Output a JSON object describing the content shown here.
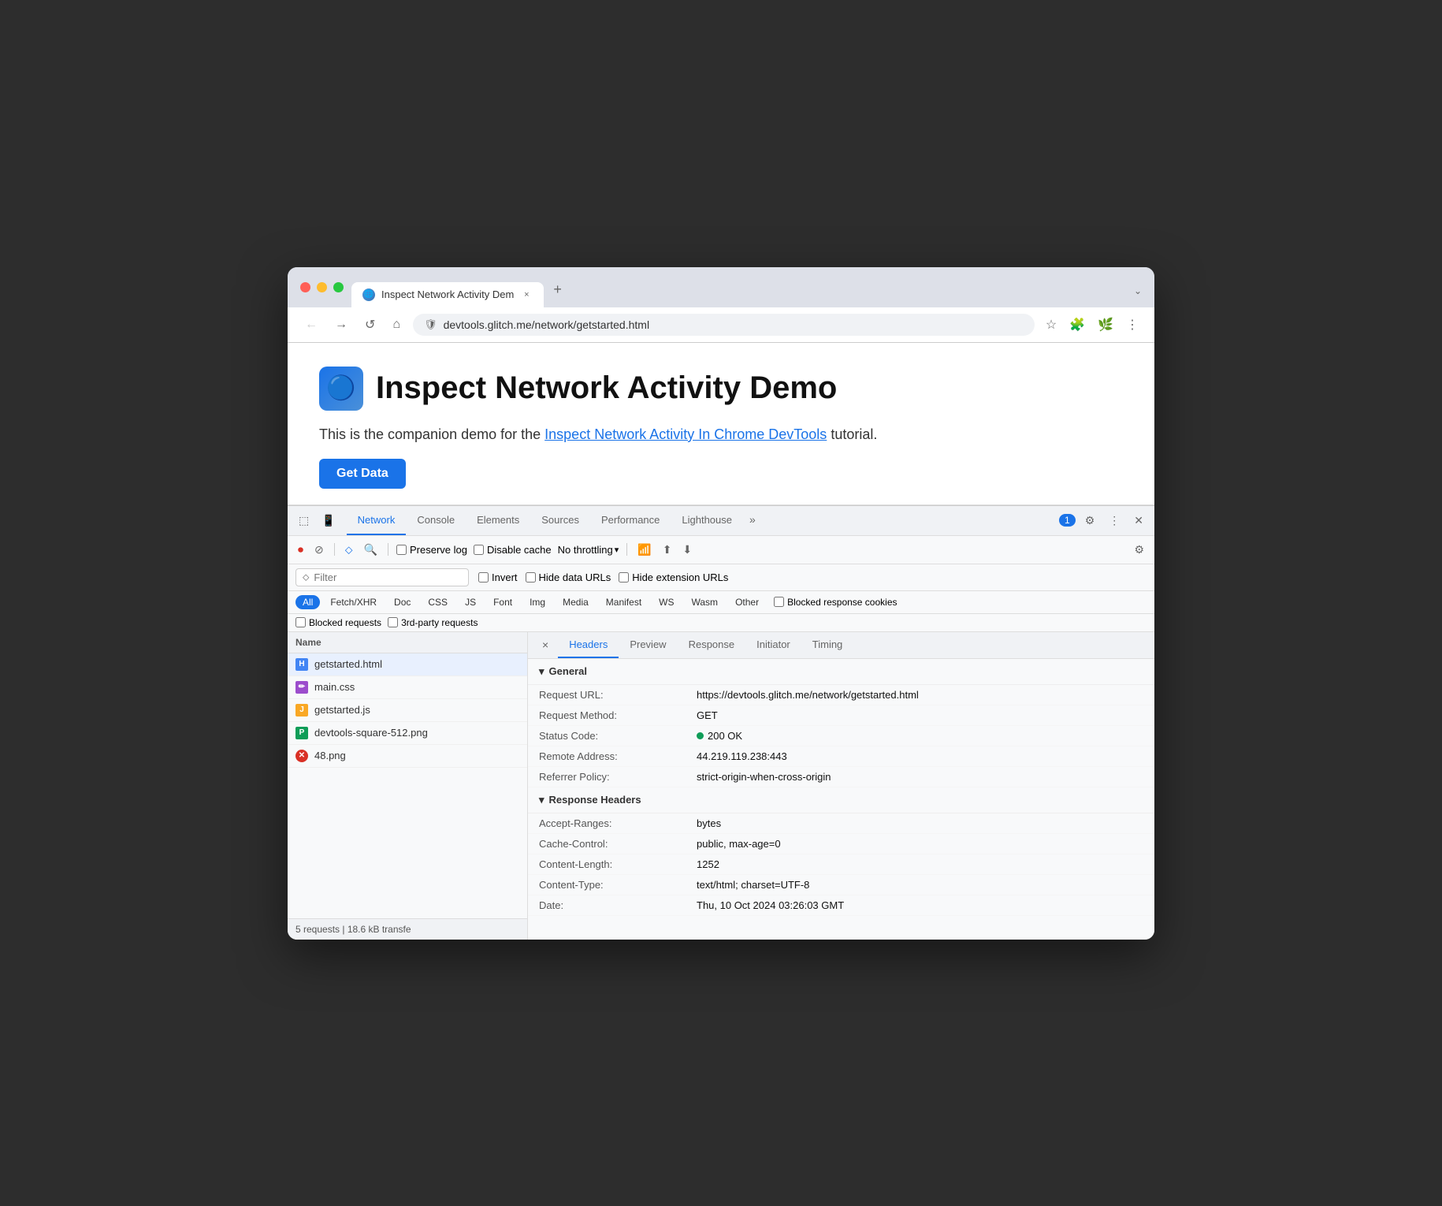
{
  "browser": {
    "tab_title": "Inspect Network Activity Dem",
    "tab_close": "×",
    "tab_new": "+",
    "url": "devtools.glitch.me/network/getstarted.html",
    "back_btn": "←",
    "forward_btn": "→",
    "refresh_btn": "↺",
    "home_btn": "⌂",
    "chevron_down": "⌄"
  },
  "page": {
    "title": "Inspect Network Activity Demo",
    "subtitle_before": "This is the companion demo for the ",
    "subtitle_link": "Inspect Network Activity In Chrome DevTools",
    "subtitle_after": " tutorial.",
    "cta_label": "Get Data",
    "logo_emoji": "🔵"
  },
  "devtools": {
    "tabs": [
      {
        "label": "Network",
        "active": true
      },
      {
        "label": "Console",
        "active": false
      },
      {
        "label": "Elements",
        "active": false
      },
      {
        "label": "Sources",
        "active": false
      },
      {
        "label": "Performance",
        "active": false
      },
      {
        "label": "Lighthouse",
        "active": false
      },
      {
        "label": "»",
        "active": false
      }
    ],
    "badge_count": "1",
    "toolbar": {
      "stop": "⏹",
      "clear": "🚫",
      "filter_icon": "⬦",
      "search_icon": "🔍",
      "preserve_log": "Preserve log",
      "disable_cache": "Disable cache",
      "throttle": "No throttling",
      "throttle_arrow": "▾",
      "offline": "📶",
      "import": "⬆",
      "export": "⬇",
      "settings": "⚙"
    },
    "filter_bar": {
      "placeholder": "Filter",
      "invert": "Invert",
      "hide_data_urls": "Hide data URLs",
      "hide_extension_urls": "Hide extension URLs"
    },
    "type_filters": [
      {
        "label": "All",
        "active": true
      },
      {
        "label": "Fetch/XHR",
        "active": false
      },
      {
        "label": "Doc",
        "active": false
      },
      {
        "label": "CSS",
        "active": false
      },
      {
        "label": "JS",
        "active": false
      },
      {
        "label": "Font",
        "active": false
      },
      {
        "label": "Img",
        "active": false
      },
      {
        "label": "Media",
        "active": false
      },
      {
        "label": "Manifest",
        "active": false
      },
      {
        "label": "WS",
        "active": false
      },
      {
        "label": "Wasm",
        "active": false
      },
      {
        "label": "Other",
        "active": false
      }
    ],
    "blocked_cookies": "Blocked response cookies",
    "extra_filters": {
      "blocked_requests": "Blocked requests",
      "third_party": "3rd-party requests"
    }
  },
  "file_list": {
    "column_header": "Name",
    "files": [
      {
        "name": "getstarted.html",
        "type": "html",
        "selected": true
      },
      {
        "name": "main.css",
        "type": "css",
        "selected": false
      },
      {
        "name": "getstarted.js",
        "type": "js",
        "selected": false
      },
      {
        "name": "devtools-square-512.png",
        "type": "png",
        "selected": false
      },
      {
        "name": "48.png",
        "type": "error",
        "selected": false
      }
    ],
    "footer": "5 requests  |  18.6 kB transfe"
  },
  "detail": {
    "close_icon": "×",
    "tabs": [
      {
        "label": "Headers",
        "active": true
      },
      {
        "label": "Preview",
        "active": false
      },
      {
        "label": "Response",
        "active": false
      },
      {
        "label": "Initiator",
        "active": false
      },
      {
        "label": "Timing",
        "active": false
      }
    ],
    "general_section": "▾ General",
    "general_rows": [
      {
        "key": "Request URL:",
        "value": "https://devtools.glitch.me/network/getstarted.html"
      },
      {
        "key": "Request Method:",
        "value": "GET"
      },
      {
        "key": "Status Code:",
        "value": "200 OK",
        "has_dot": true
      },
      {
        "key": "Remote Address:",
        "value": "44.219.119.238:443"
      },
      {
        "key": "Referrer Policy:",
        "value": "strict-origin-when-cross-origin"
      }
    ],
    "response_section": "▾ Response Headers",
    "response_rows": [
      {
        "key": "Accept-Ranges:",
        "value": "bytes"
      },
      {
        "key": "Cache-Control:",
        "value": "public, max-age=0"
      },
      {
        "key": "Content-Length:",
        "value": "1252"
      },
      {
        "key": "Content-Type:",
        "value": "text/html; charset=UTF-8"
      },
      {
        "key": "Date:",
        "value": "Thu, 10 Oct 2024 03:26:03 GMT"
      }
    ]
  },
  "colors": {
    "active_tab": "#1a73e8",
    "stop_red": "#d93025",
    "success_green": "#0f9d58"
  }
}
